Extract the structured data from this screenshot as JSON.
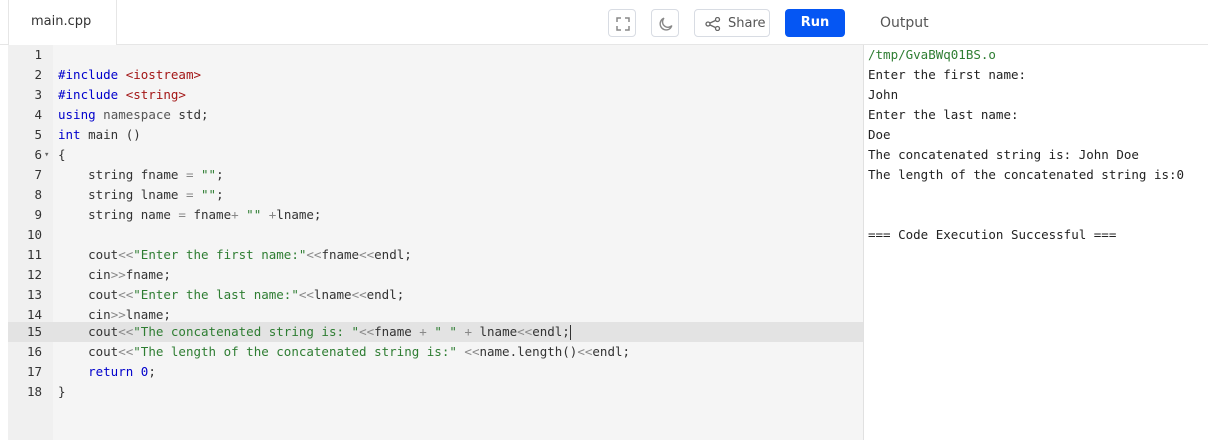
{
  "tab": {
    "filename": "main.cpp"
  },
  "toolbar": {
    "fullscreen_icon": "fullscreen-icon",
    "theme_icon": "moon-icon",
    "share_icon": "share-icon",
    "share_label": "Share",
    "run_label": "Run",
    "run_color": "#0556f3"
  },
  "output_panel": {
    "title": "Output"
  },
  "editor": {
    "active_line": 15,
    "lines": [
      {
        "n": "1",
        "text": ""
      },
      {
        "n": "2",
        "text": "#include <iostream>"
      },
      {
        "n": "3",
        "text": "#include <string>"
      },
      {
        "n": "4",
        "text": "using namespace std;"
      },
      {
        "n": "5",
        "text": "int main ()"
      },
      {
        "n": "6",
        "text": "{"
      },
      {
        "n": "7",
        "text": "    string fname = \"\";"
      },
      {
        "n": "8",
        "text": "    string lname = \"\";"
      },
      {
        "n": "9",
        "text": "    string name = fname+ \"\" +lname;"
      },
      {
        "n": "10",
        "text": ""
      },
      {
        "n": "11",
        "text": "    cout<<\"Enter the first name:\"<<fname<<endl;"
      },
      {
        "n": "12",
        "text": "    cin>>fname;"
      },
      {
        "n": "13",
        "text": "    cout<<\"Enter the last name:\"<<lname<<endl;"
      },
      {
        "n": "14",
        "text": "    cin>>lname;"
      },
      {
        "n": "15",
        "text": "    cout<<\"The concatenated string is: \"<<fname + \" \" + lname<<endl;"
      },
      {
        "n": "16",
        "text": "    cout<<\"The length of the concatenated string is:\" <<name.length()<<endl;"
      },
      {
        "n": "17",
        "text": "    return 0;"
      },
      {
        "n": "18",
        "text": "}"
      }
    ]
  },
  "output": {
    "lines": [
      "/tmp/GvaBWq01BS.o",
      "Enter the first name:",
      "John",
      "Enter the last name:",
      "Doe",
      "The concatenated string is: John Doe",
      "The length of the concatenated string is:0",
      "",
      "",
      "=== Code Execution Successful ==="
    ]
  }
}
